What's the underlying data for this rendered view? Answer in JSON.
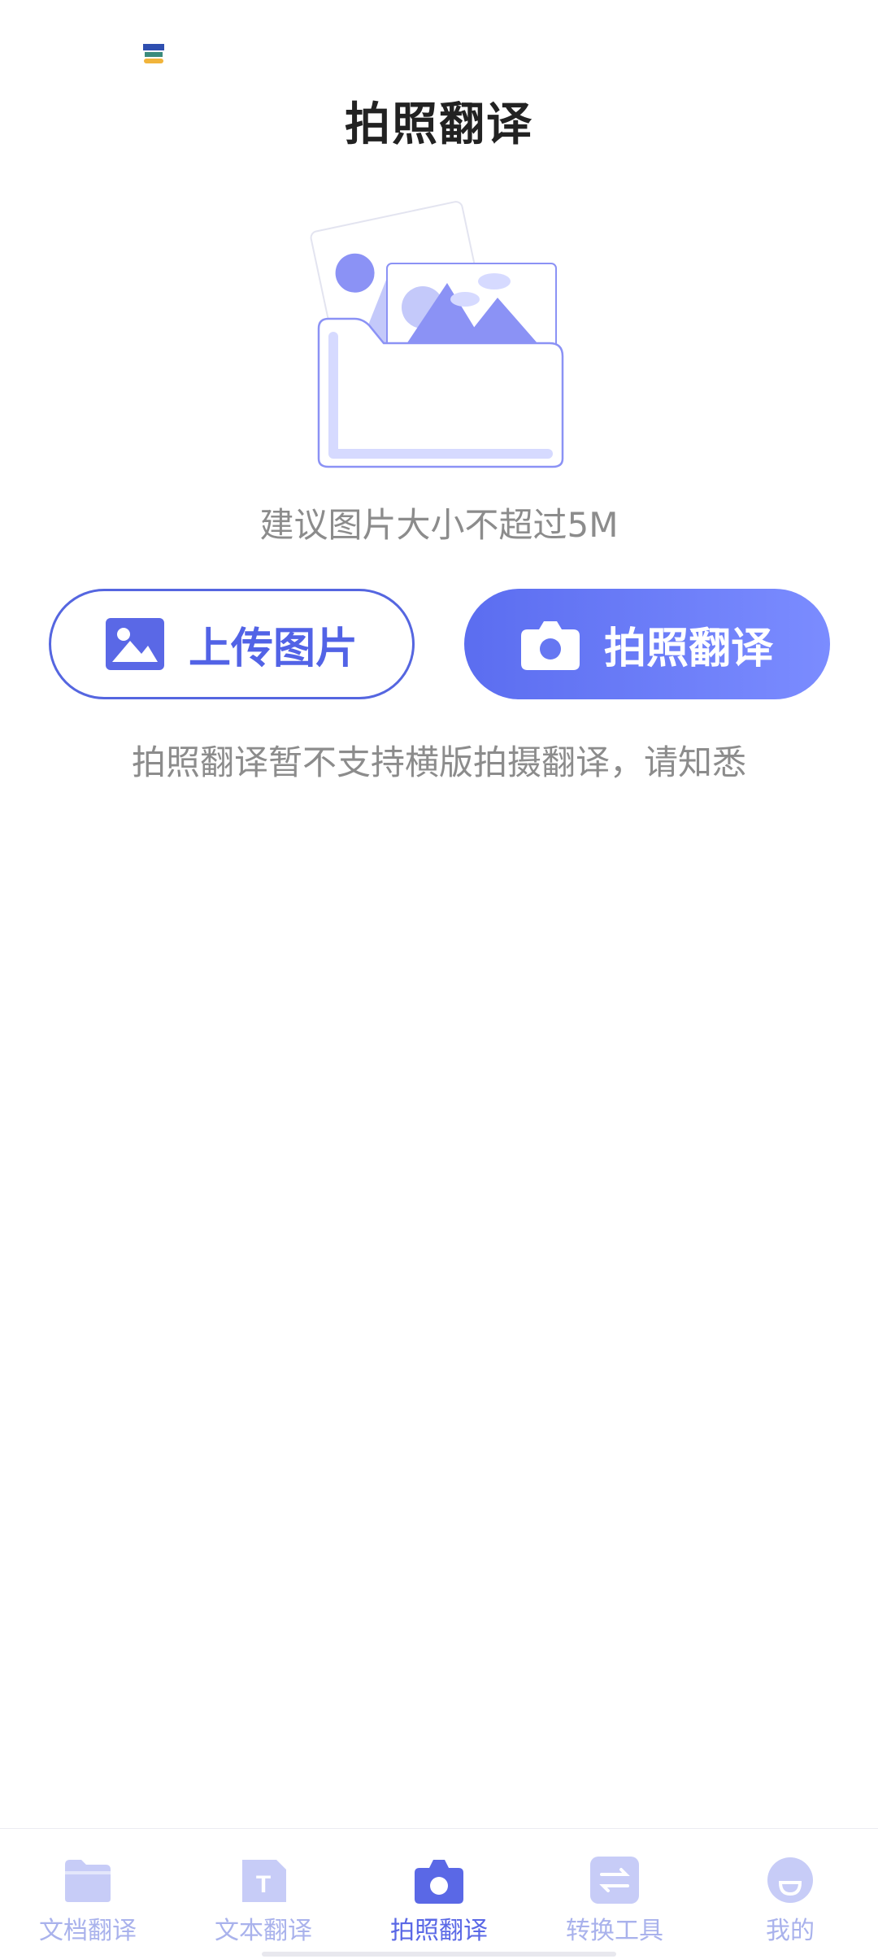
{
  "status_bar": {
    "app_badge_icon": "app-logo-icon"
  },
  "header": {
    "title": "拍照翻译"
  },
  "illustration": {
    "icon": "photo-folder-illustration"
  },
  "main": {
    "size_hint": "建议图片大小不超过5M",
    "upload_button": {
      "label": "上传图片",
      "icon": "image-icon"
    },
    "camera_button": {
      "label": "拍照翻译",
      "icon": "camera-icon"
    },
    "notice": "拍照翻译暂不支持横版拍摄翻译，请知悉"
  },
  "tabbar": {
    "tabs": [
      {
        "label": "文档翻译",
        "icon": "folder-icon",
        "active": false
      },
      {
        "label": "文本翻译",
        "icon": "text-document-icon",
        "active": false
      },
      {
        "label": "拍照翻译",
        "icon": "camera-icon",
        "active": true
      },
      {
        "label": "转换工具",
        "icon": "swap-icon",
        "active": false
      },
      {
        "label": "我的",
        "icon": "profile-face-icon",
        "active": false
      }
    ]
  },
  "colors": {
    "accent": "#5a68e6",
    "accent_light": "#a9b2ec",
    "hint_text": "#8c8c8c",
    "title_text": "#222222"
  }
}
